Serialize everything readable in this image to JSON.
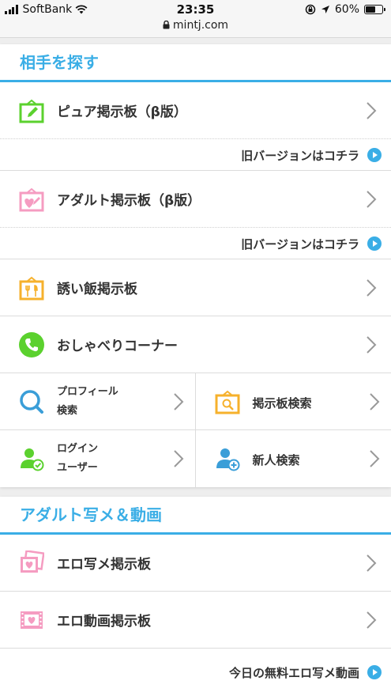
{
  "status_bar": {
    "carrier": "SoftBank",
    "time": "23:35",
    "url": "mintj.com",
    "battery": "60%",
    "battery_level": 0.6
  },
  "section1": {
    "title": "相手を探す",
    "pure_board": "ピュア掲示板（β版）",
    "old_version_1": "旧バージョンはコチラ",
    "adult_board": "アダルト掲示板（β版）",
    "old_version_2": "旧バージョンはコチラ",
    "meal_board": "誘い飯掲示板",
    "chat_corner": "おしゃべりコーナー",
    "profile_search_line1": "プロフィール",
    "profile_search_line2": "検索",
    "board_search": "掲示板検索",
    "login_users_line1": "ログイン",
    "login_users_line2": "ユーザー",
    "newcomer_search": "新人検索"
  },
  "section2": {
    "title": "アダルト写メ＆動画",
    "photo_board": "エロ写メ掲示板",
    "video_board": "エロ動画掲示板",
    "today_free": "今日の無料エロ写メ動画"
  },
  "colors": {
    "accent": "#3aaee6",
    "green": "#5bd12e",
    "pink": "#f59cc1",
    "orange": "#f6b12c",
    "blue": "#3a9ed8"
  }
}
